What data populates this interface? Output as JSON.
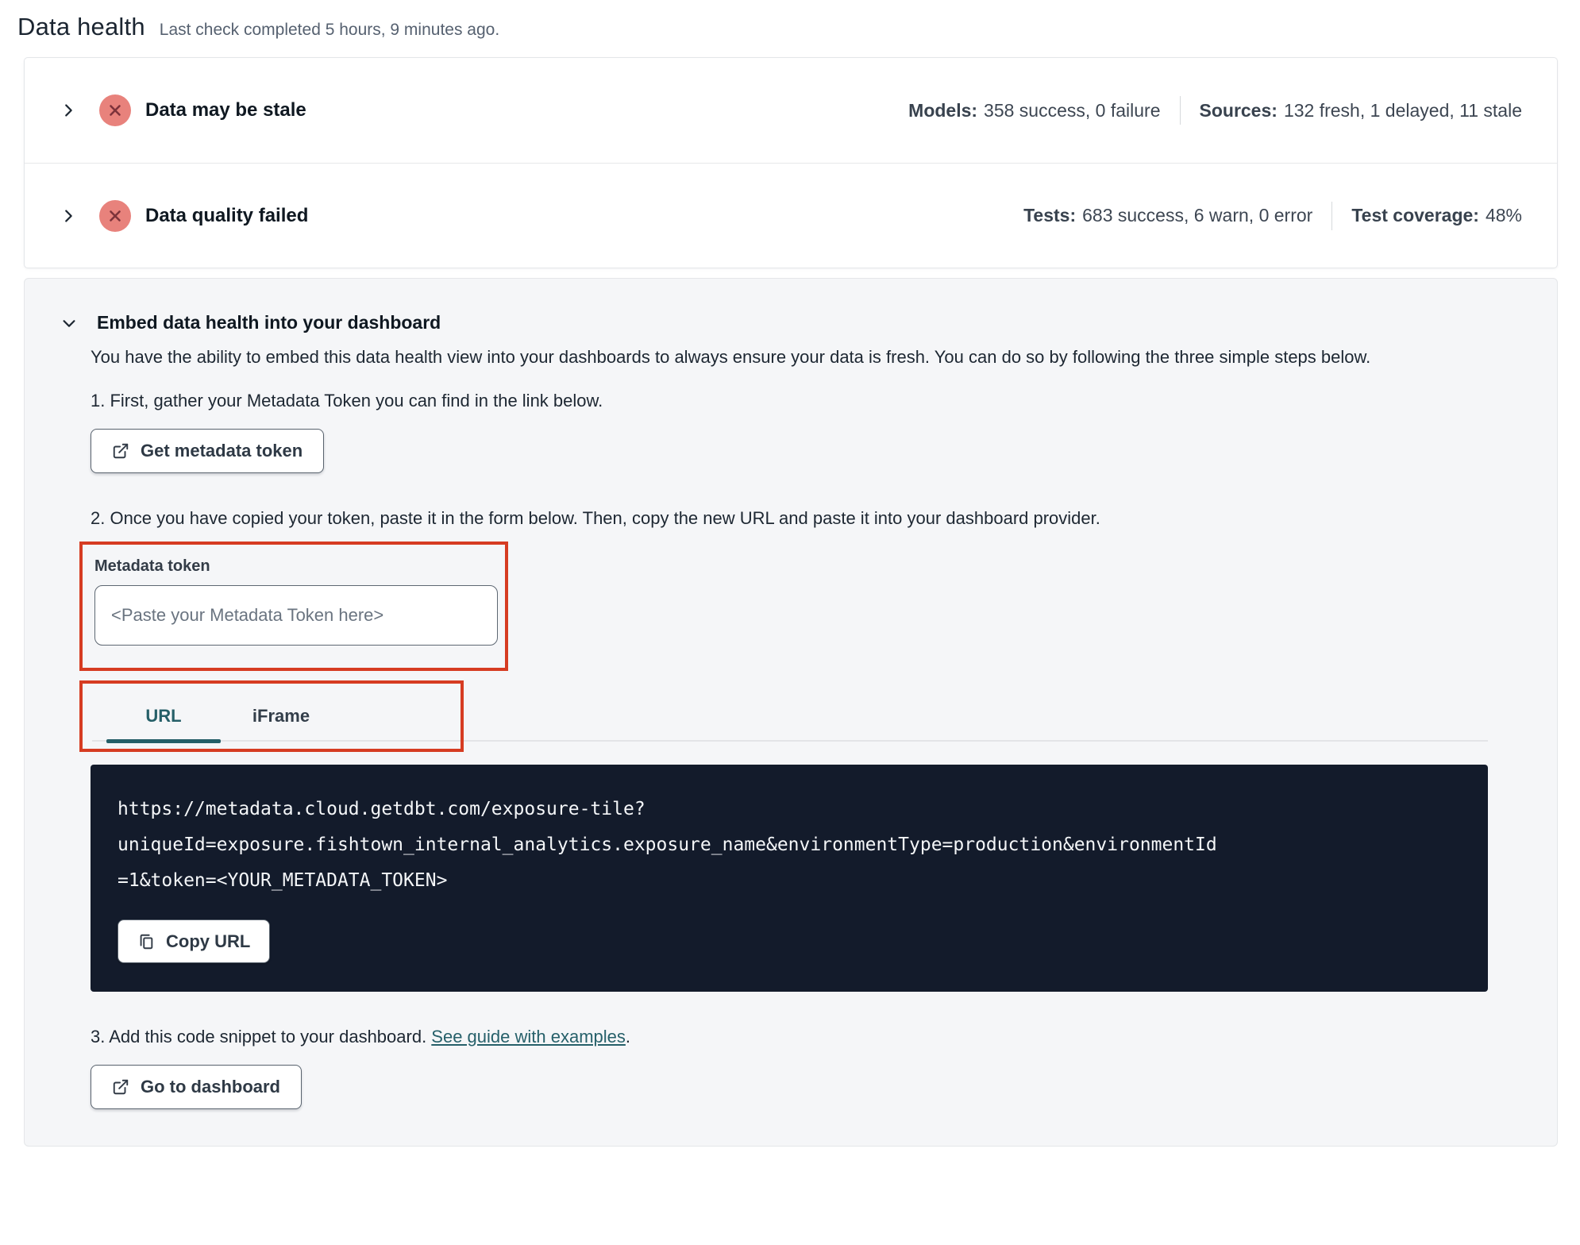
{
  "page": {
    "title": "Data health",
    "subtitle": "Last check completed 5 hours, 9 minutes ago."
  },
  "rows": [
    {
      "label": "Data may be stale",
      "status_icon": "error-x-circle",
      "stats": [
        {
          "label": "Models:",
          "value": "358 success, 0 failure"
        },
        {
          "label": "Sources:",
          "value": "132 fresh, 1 delayed, 11 stale"
        }
      ]
    },
    {
      "label": "Data quality failed",
      "status_icon": "error-x-circle",
      "stats": [
        {
          "label": "Tests:",
          "value": "683 success, 6 warn, 0 error"
        },
        {
          "label": "Test coverage:",
          "value": "48%"
        }
      ]
    }
  ],
  "embed": {
    "title": "Embed data health into your dashboard",
    "description": "You have the ability to embed this data health view into your dashboards to always ensure your data is fresh. You can do so by following the three simple steps below.",
    "step1": "1. First, gather your Metadata Token you can find in the link below.",
    "step2": "2. Once you have copied your token, paste it in the form below. Then, copy the new URL and paste it into your dashboard provider.",
    "step3": {
      "text": "3. Add this code snippet to your dashboard. ",
      "link": "See guide with examples",
      "suffix": "."
    },
    "token": {
      "label": "Metadata token",
      "value": "",
      "placeholder": "<Paste your Metadata Token here>"
    },
    "tabs": [
      {
        "label": "URL",
        "active": true
      },
      {
        "label": "iFrame",
        "active": false
      }
    ],
    "code_lines": [
      "https://metadata.cloud.getdbt.com/exposure-tile?",
      "uniqueId=exposure.fishtown_internal_analytics.exposure_name&environmentType=production&environmentId",
      "=1&token=<YOUR_METADATA_TOKEN>"
    ],
    "code_url": "https://metadata.cloud.getdbt.com/exposure-tile?uniqueId=exposure.fishtown_internal_analytics.exposure_name&environmentType=production&environmentId=1&token=<YOUR_METADATA_TOKEN>",
    "buttons": {
      "get_token": "Get metadata token",
      "copy_url": "Copy URL",
      "go_dashboard": "Go to dashboard"
    }
  },
  "colors": {
    "annotation_red": "#d63c22",
    "teal_accent": "#255f68",
    "error_icon_bg": "#e8827c",
    "error_icon_x": "#7d333b",
    "code_block_bg": "#131b2b",
    "card_bg": "#f5f6f8"
  }
}
